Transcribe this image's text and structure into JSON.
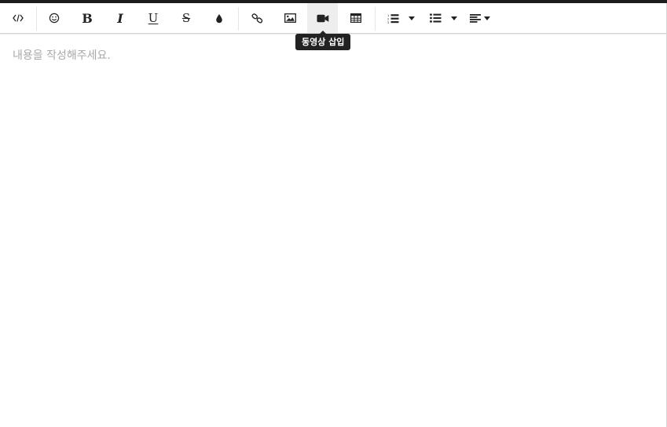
{
  "toolbar": {
    "buttons": [
      {
        "id": "code-view",
        "icon": "code-icon"
      },
      {
        "id": "emoji",
        "icon": "smiley-icon"
      },
      {
        "id": "bold",
        "icon": "bold-icon",
        "glyph": "B"
      },
      {
        "id": "italic",
        "icon": "italic-icon",
        "glyph": "I"
      },
      {
        "id": "underline",
        "icon": "underline-icon",
        "glyph": "U"
      },
      {
        "id": "strikethrough",
        "icon": "strikethrough-icon",
        "glyph": "S"
      },
      {
        "id": "font-color",
        "icon": "droplet-icon"
      },
      {
        "id": "link",
        "icon": "link-icon"
      },
      {
        "id": "image",
        "icon": "image-icon"
      },
      {
        "id": "video",
        "icon": "video-camera-icon",
        "active": true
      },
      {
        "id": "table",
        "icon": "table-icon"
      },
      {
        "id": "ordered-list",
        "icon": "ordered-list-icon",
        "dropdown": true
      },
      {
        "id": "unordered-list",
        "icon": "unordered-list-icon",
        "dropdown": true
      },
      {
        "id": "align",
        "icon": "align-left-icon",
        "dropdown": true
      }
    ]
  },
  "tooltip": {
    "text": "동영상 삽입"
  },
  "editor": {
    "placeholder": "내용을 작성해주세요."
  },
  "colors": {
    "top_strip": "#1c1c1c",
    "active_button_bg": "#eeeeee",
    "tooltip_bg": "#222222",
    "placeholder_text": "#a8a8a8"
  }
}
